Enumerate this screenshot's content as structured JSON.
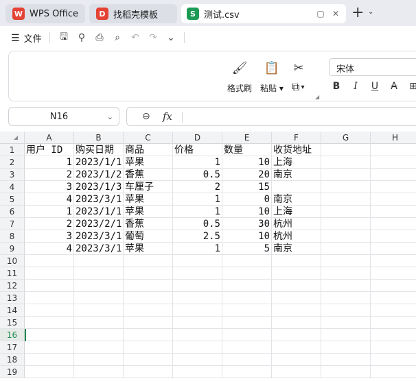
{
  "tabs": {
    "wps": {
      "label": "WPS Office",
      "logo": "W"
    },
    "template": {
      "label": "找稻壳模板",
      "logo": "D"
    },
    "csv": {
      "label": "测试.csv",
      "logo": "S"
    }
  },
  "quickbar": {
    "menu_label": "文件",
    "icons": [
      "save-icon",
      "share-icon",
      "print-icon",
      "print-preview-icon",
      "undo-icon",
      "redo-icon",
      "more-chevron-icon"
    ]
  },
  "ribbon": {
    "format_painter_label": "格式刷",
    "paste_label": "粘贴",
    "font_name": "宋体",
    "format_buttons": [
      "B",
      "I",
      "U",
      "A"
    ]
  },
  "formula_bar": {
    "name_box": "N16",
    "fx_label": "fx"
  },
  "sheet": {
    "active_row": 16,
    "columns": [
      "A",
      "B",
      "C",
      "D",
      "E",
      "F",
      "G",
      "H"
    ],
    "row_numbers": [
      1,
      2,
      3,
      4,
      5,
      6,
      7,
      8,
      9,
      10,
      11,
      12,
      13,
      14,
      15,
      16,
      17,
      18,
      19
    ],
    "header_row": [
      "用户 ID",
      "购买日期",
      "商品",
      "价格",
      "数量",
      "收货地址"
    ],
    "data_rows": [
      [
        "1",
        "2023/1/1",
        "苹果",
        "1",
        "10",
        "上海"
      ],
      [
        "2",
        "2023/1/2",
        "香蕉",
        "0.5",
        "20",
        "南京"
      ],
      [
        "3",
        "2023/1/3",
        "车厘子",
        "2",
        "15",
        ""
      ],
      [
        "4",
        "2023/3/1",
        "苹果",
        "1",
        "0",
        "南京"
      ],
      [
        "1",
        "2023/1/1",
        "苹果",
        "1",
        "10",
        "上海"
      ],
      [
        "2",
        "2023/2/1",
        "香蕉",
        "0.5",
        "30",
        "杭州"
      ],
      [
        "3",
        "2023/3/1",
        "葡萄",
        "2.5",
        "10",
        "杭州"
      ],
      [
        "4",
        "2023/3/1",
        "苹果",
        "1",
        "5",
        "南京"
      ]
    ]
  },
  "colors": {
    "accent": "#1a8a4b",
    "tabbar": "#e9ebf0"
  }
}
